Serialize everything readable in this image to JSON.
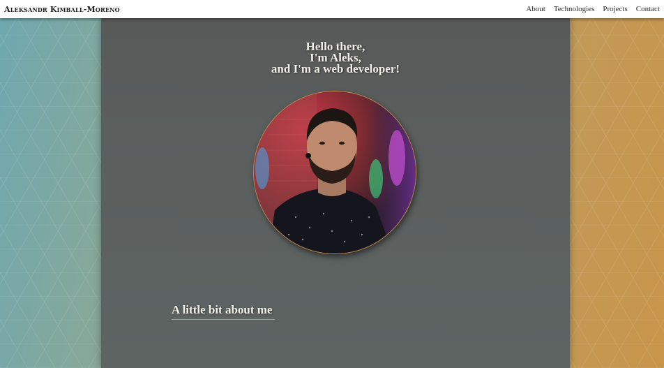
{
  "navbar": {
    "brand": "Aleksandr Kimball-Moreno",
    "links": [
      "About",
      "Technologies",
      "Projects",
      "Contact"
    ]
  },
  "hero": {
    "line1": "Hello there,",
    "line2": "I'm Aleks,",
    "line3": "and I'm a web developer!"
  },
  "about": {
    "heading": "A little bit about me"
  },
  "colors": {
    "accent": "#c99658",
    "panel": "#5a5e5d",
    "nav_bg": "#ffffff",
    "text_light": "#f2efe8"
  }
}
